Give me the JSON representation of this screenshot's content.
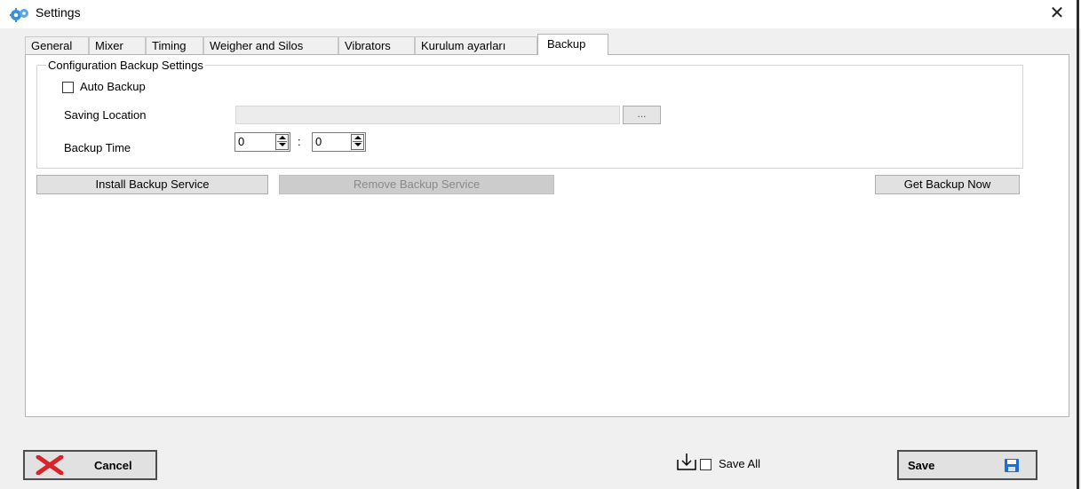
{
  "window": {
    "title": "Settings",
    "close_glyph": "✕",
    "icon": "gears-icon"
  },
  "tabs": [
    {
      "label": "General"
    },
    {
      "label": "Mixer"
    },
    {
      "label": "Timing"
    },
    {
      "label": "Weigher and Silos"
    },
    {
      "label": "Vibrators"
    },
    {
      "label": "Kurulum ayarları"
    },
    {
      "label": "Backup",
      "active": true
    }
  ],
  "backup": {
    "group_title": "Configuration Backup Settings",
    "auto_backup_label": "Auto Backup",
    "auto_backup_checked": false,
    "saving_location_label": "Saving Location",
    "saving_location_value": "",
    "browse_label": "...",
    "backup_time_label": "Backup Time",
    "hour_value": "0",
    "time_separator": ":",
    "minute_value": "0",
    "install_label": "Install Backup Service",
    "remove_label": "Remove Backup Service",
    "get_backup_label": "Get Backup Now"
  },
  "footer": {
    "cancel_label": "Cancel",
    "save_all_label": "Save All",
    "save_all_checked": false,
    "save_label": "Save"
  },
  "colors": {
    "cancel_icon": "#d9232b",
    "save_icon": "#1b6fd1",
    "app_icon": "#3a8fd9"
  }
}
